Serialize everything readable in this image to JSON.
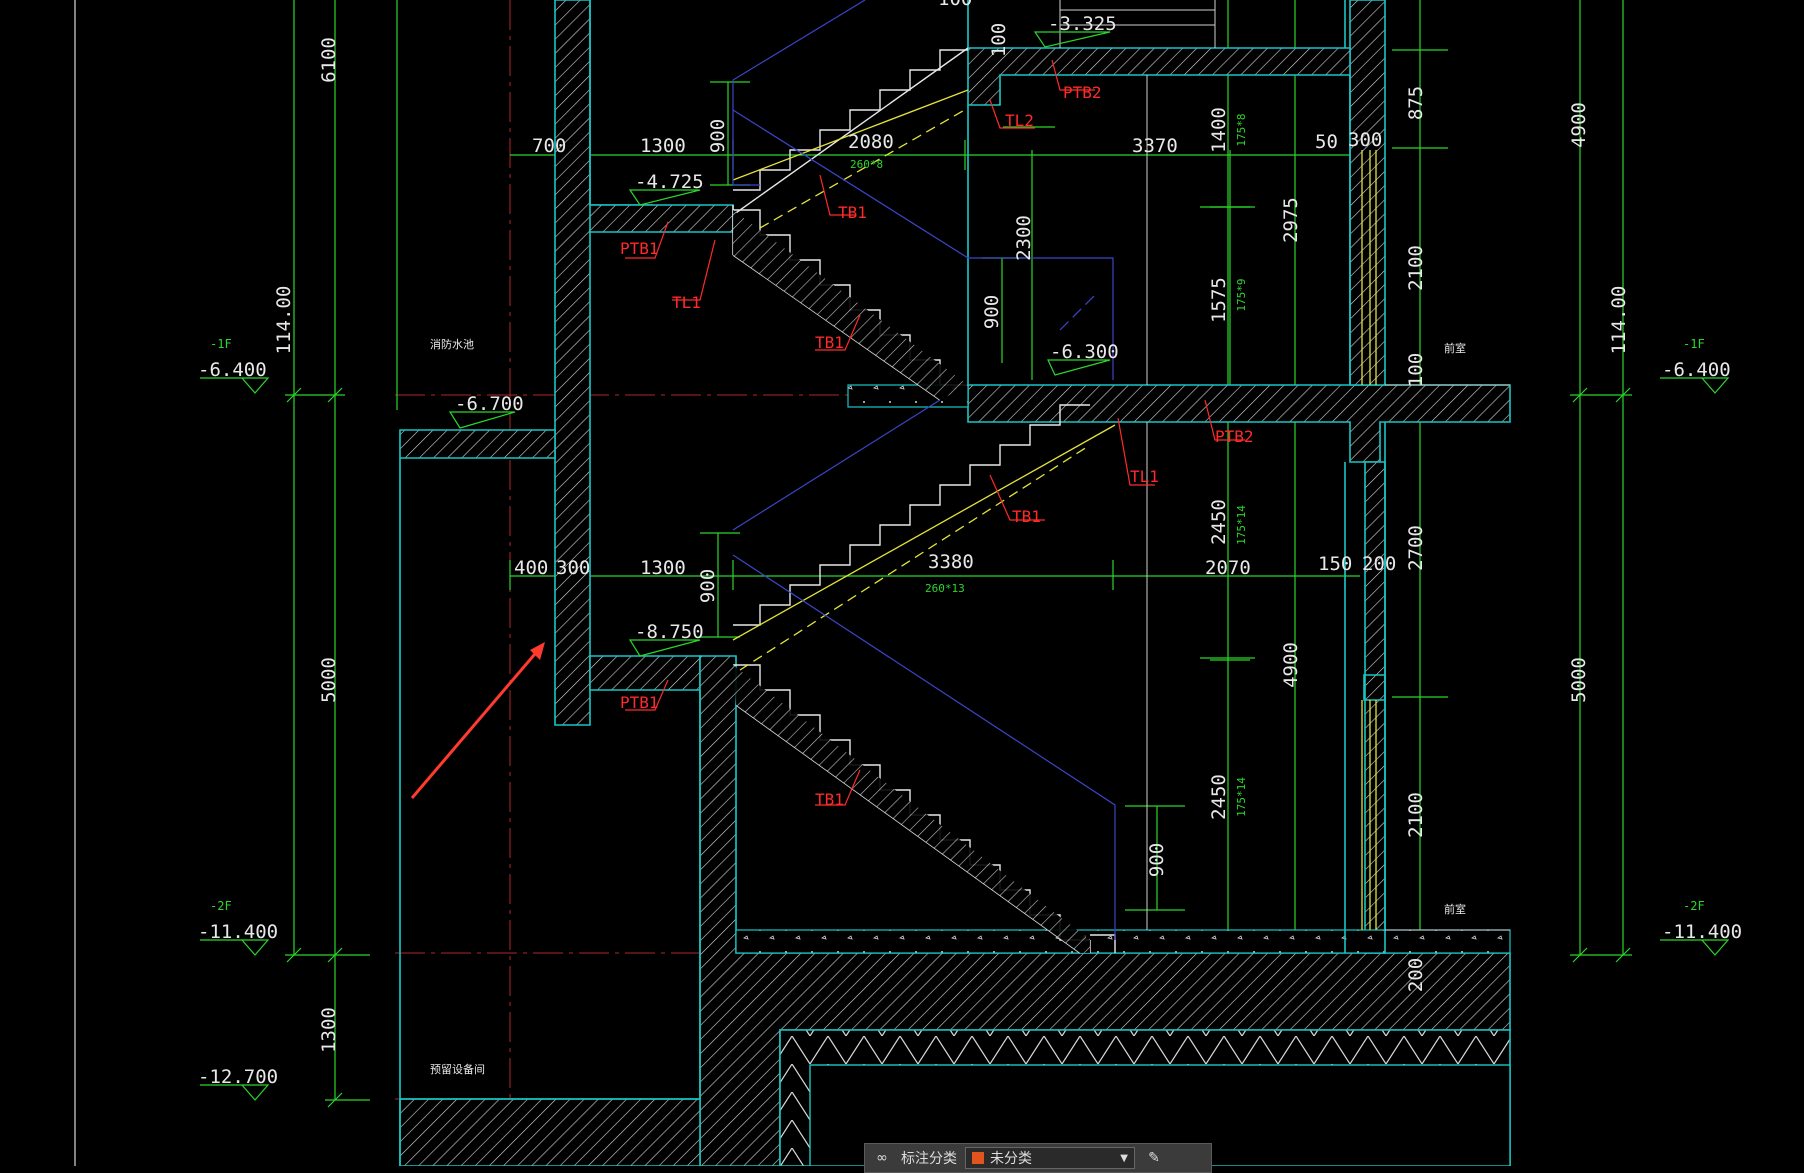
{
  "dims_left": [
    "6100",
    "114.00",
    "5000",
    "1300"
  ],
  "dims_right": [
    "4900",
    "114.00",
    "5000"
  ],
  "dims_mid": [
    "875",
    "2100",
    "2700",
    "2100",
    "200",
    "100",
    "2975",
    "4900",
    "1400",
    "1575",
    "2450",
    "2450",
    "2300",
    "900",
    "900",
    "900",
    "900",
    "100",
    "100"
  ],
  "dims_h_top": [
    "700",
    "1300",
    "2080",
    "3370",
    "50",
    "300"
  ],
  "dims_h_bot": [
    "400",
    "300",
    "1300",
    "3380",
    "2070",
    "150",
    "200"
  ],
  "steps": [
    "260*8",
    "260*13",
    "175*8",
    "175*9",
    "175*14",
    "175*14"
  ],
  "elev": [
    "-3.325",
    "-4.725",
    "-6.300",
    "-6.700",
    "-8.750"
  ],
  "levels": [
    {
      "floor": "-1F",
      "value": "-6.400"
    },
    {
      "floor": "-2F",
      "value": "-11.400"
    },
    {
      "floor": "",
      "value": "-12.700"
    }
  ],
  "components": {
    "ptb2": "PTB2",
    "tl2": "TL2",
    "tb1": "TB1",
    "ptb1": "PTB1",
    "tl1": "TL1"
  },
  "rooms": {
    "fire_pool": "消防水池",
    "equipment": "预留设备间",
    "anteroom": "前室"
  },
  "toolbar": {
    "label": "标注分类",
    "selected": "未分类"
  },
  "colors": {
    "wall": "#19c6c6",
    "dimension": "#2bd62b",
    "tag": "#ff2a2a",
    "stair": "#ffffff",
    "handrail": "#e3e33a",
    "hidden": "#3a46c8",
    "arrow": "#ff3b2f",
    "axis": "#c03030"
  }
}
